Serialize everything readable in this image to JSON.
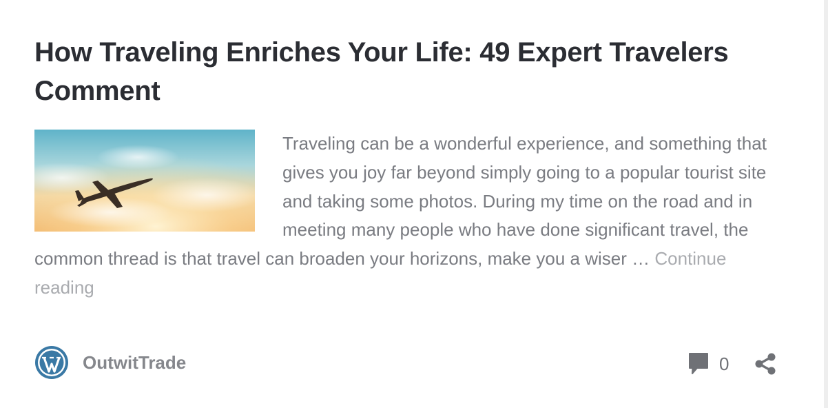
{
  "post": {
    "title": "How Traveling Enriches Your Life: 49 Expert Travelers Comment",
    "excerpt": "Traveling can be a wonderful experience, and something that gives you joy far beyond simply going to a popular tourist site and taking some photos. During my time on the road and in meeting many people who have done significant travel, the common thread is that travel can broaden your horizons, make you a wiser … ",
    "continue_label": "Continue reading",
    "image_label": "airplane-at-sunset-photo"
  },
  "footer": {
    "author_name": "OutwitTrade",
    "avatar_icon": "wordpress-logo-icon",
    "comment_icon": "comment-bubble-icon",
    "comment_count": "0",
    "share_icon": "share-icon"
  },
  "colors": {
    "title": "#2b2d33",
    "body_text": "#7a7c82",
    "link": "#a9abaf",
    "author": "#85878c",
    "wordpress_blue": "#3a79a5",
    "icon": "#6f7176"
  }
}
